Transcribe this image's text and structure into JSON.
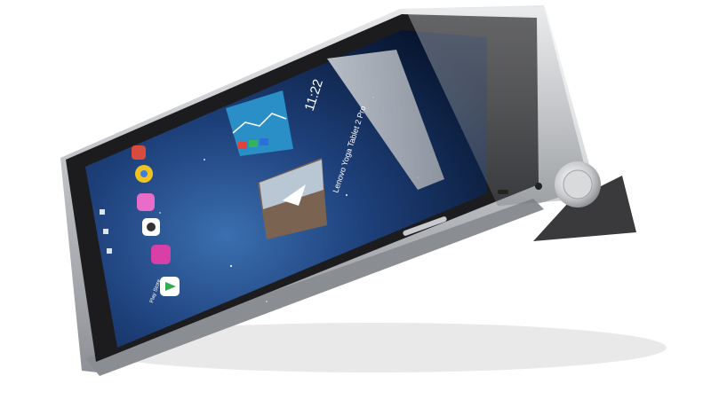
{
  "photo": {
    "subject": "Lenovo Yoga Tablet 2 Pro tablet standing on its kickstand",
    "colors": {
      "background": "#ffffff",
      "bezel": "#1c1c1e",
      "frame": "#b9bcc0",
      "kickstand": "#3a3a3c",
      "screen_sky_top": "#0b1b3a",
      "screen_sky_bottom": "#2a5f9e"
    }
  },
  "screen": {
    "clock": "11:22",
    "news_headline": "Lenovo Yoga Tablet 2 Pro",
    "app_labels": [
      "Play Store"
    ]
  },
  "icons": [
    "weather-widget-icon",
    "clock-widget-icon",
    "news-widget-icon",
    "chrome-icon",
    "gallery-icon",
    "camera-icon",
    "music-icon",
    "play-store-icon",
    "rotation-hinge-icon"
  ]
}
